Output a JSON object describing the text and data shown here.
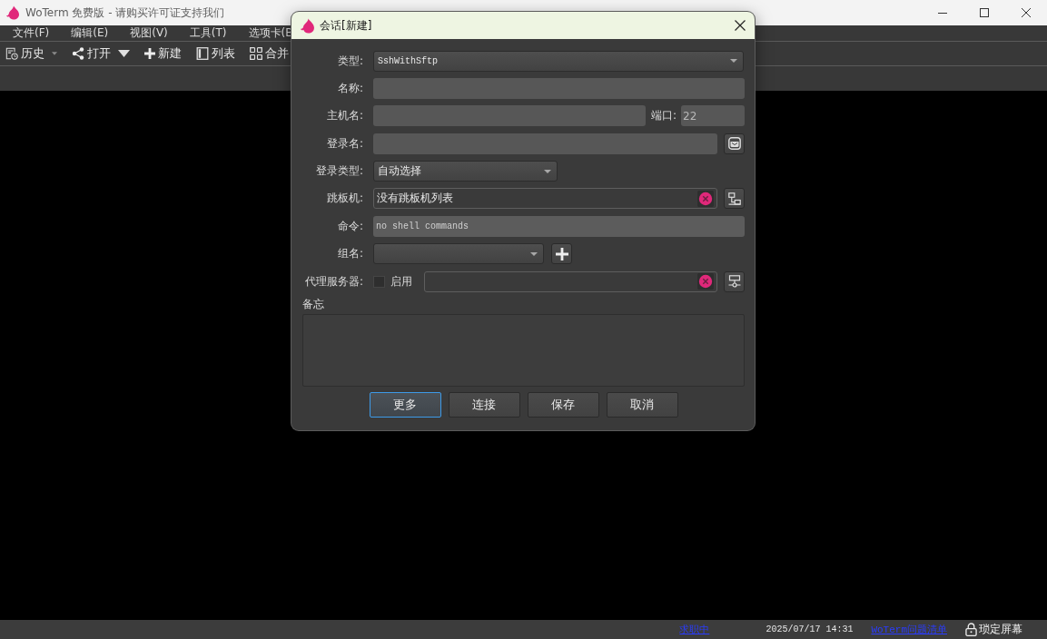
{
  "window": {
    "title": "WoTerm 免费版 - 请购买许可证支持我们"
  },
  "menu": [
    "文件(F)",
    "编辑(E)",
    "视图(V)",
    "工具(T)",
    "选项卡(B"
  ],
  "toolbar": [
    {
      "kind": "history",
      "label": "历史",
      "dropdown": true
    },
    {
      "kind": "share",
      "label": "打开",
      "dropdown": true
    },
    {
      "kind": "new",
      "label": "新建",
      "dropdown": false
    },
    {
      "kind": "list",
      "label": "列表",
      "dropdown": false
    },
    {
      "kind": "merge",
      "label": "合并",
      "dropdown": false
    }
  ],
  "dialog": {
    "title": "会话[新建]",
    "type": {
      "label": "类型:",
      "value": "SshWithSftp"
    },
    "name": {
      "label": "名称:"
    },
    "host": {
      "label": "主机名:"
    },
    "port": {
      "label": "端口:",
      "placeholder": "22"
    },
    "login": {
      "label": "登录名:"
    },
    "login_type": {
      "label": "登录类型:",
      "value": "自动选择"
    },
    "jump": {
      "label": "跳板机:",
      "value": "没有跳板机列表"
    },
    "command": {
      "label": "命令:",
      "placeholder": "no shell commands"
    },
    "group": {
      "label": "组名:"
    },
    "proxy": {
      "label": "代理服务器:",
      "checkbox": {
        "label": "启用",
        "checked": false
      }
    },
    "memo": {
      "label": "备忘"
    },
    "buttons": [
      {
        "label": "更多",
        "focused": true
      },
      {
        "label": "连接",
        "focused": false
      },
      {
        "label": "保存",
        "focused": false
      },
      {
        "label": "取消",
        "focused": false
      }
    ]
  },
  "status_bar": [
    {
      "kind": "link",
      "text": "求职中"
    },
    {
      "kind": "time",
      "text": "2025/07/17 14:31"
    },
    {
      "kind": "link",
      "text": "WoTerm问题清单"
    },
    {
      "kind": "lock",
      "text": "琐定屏幕"
    }
  ]
}
